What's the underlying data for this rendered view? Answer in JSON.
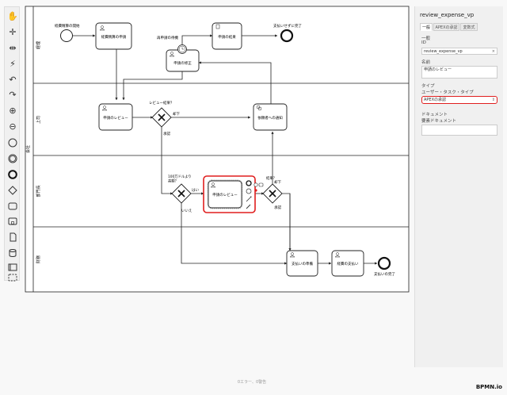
{
  "diagram": {
    "pool_label": "会社",
    "lanes": [
      {
        "name": "経理"
      },
      {
        "name": "上司"
      },
      {
        "name": "部門長"
      },
      {
        "name": "財務"
      }
    ],
    "nodes": {
      "start_event": {
        "label": "経費精算の開始"
      },
      "task_apply": {
        "label": "経費精算の申請"
      },
      "task_result": {
        "label": "申請の結果"
      },
      "end_not_paid": {
        "label": "支払いせずに完了"
      },
      "timer_label": {
        "label": "再申請の待機"
      },
      "task_fix": {
        "label": "申請の修正"
      },
      "task_review_boss": {
        "label": "申請のレビュー"
      },
      "gw_review_result": {
        "label": "レビュー結果？"
      },
      "task_notify": {
        "label": "依頼者への通知"
      },
      "gw_amount": {
        "label": "100万ドルより\n高額？"
      },
      "task_review_dept": {
        "label": "申請のレビュー"
      },
      "gw_approved": {
        "label": "結果？"
      },
      "task_prepare": {
        "label": "支払いの準備"
      },
      "task_pay": {
        "label": "経費の支払い"
      },
      "end_paid": {
        "label": "支払いの完了"
      }
    },
    "flow_labels": {
      "reject_boss": "却下",
      "approve_boss": "承認",
      "yes": "はい",
      "no": "いいえ",
      "reject_dept": "却下",
      "approve_dept": "承認"
    }
  },
  "properties": {
    "title": "review_expense_vp",
    "tabs": [
      "一般",
      "APEXの承認",
      "変数式"
    ],
    "section_general": "一般",
    "id_label": "ID",
    "id_value": "review_expense_vp",
    "name_label": "名前",
    "name_value": "申請のレビュー",
    "type_section": "タイプ",
    "type_label": "ユーザー・タスク・タイプ",
    "type_value": "APEXの承認",
    "doc_section": "ドキュメント",
    "doc_label": "要素ドキュメント",
    "clear_glyph": "×",
    "dropdown_glyph": "⇕"
  },
  "status": "0エラー、0警告",
  "logo": "BPMN.io",
  "colors": {
    "highlight": "#e01e1e",
    "stroke": "#222222"
  }
}
